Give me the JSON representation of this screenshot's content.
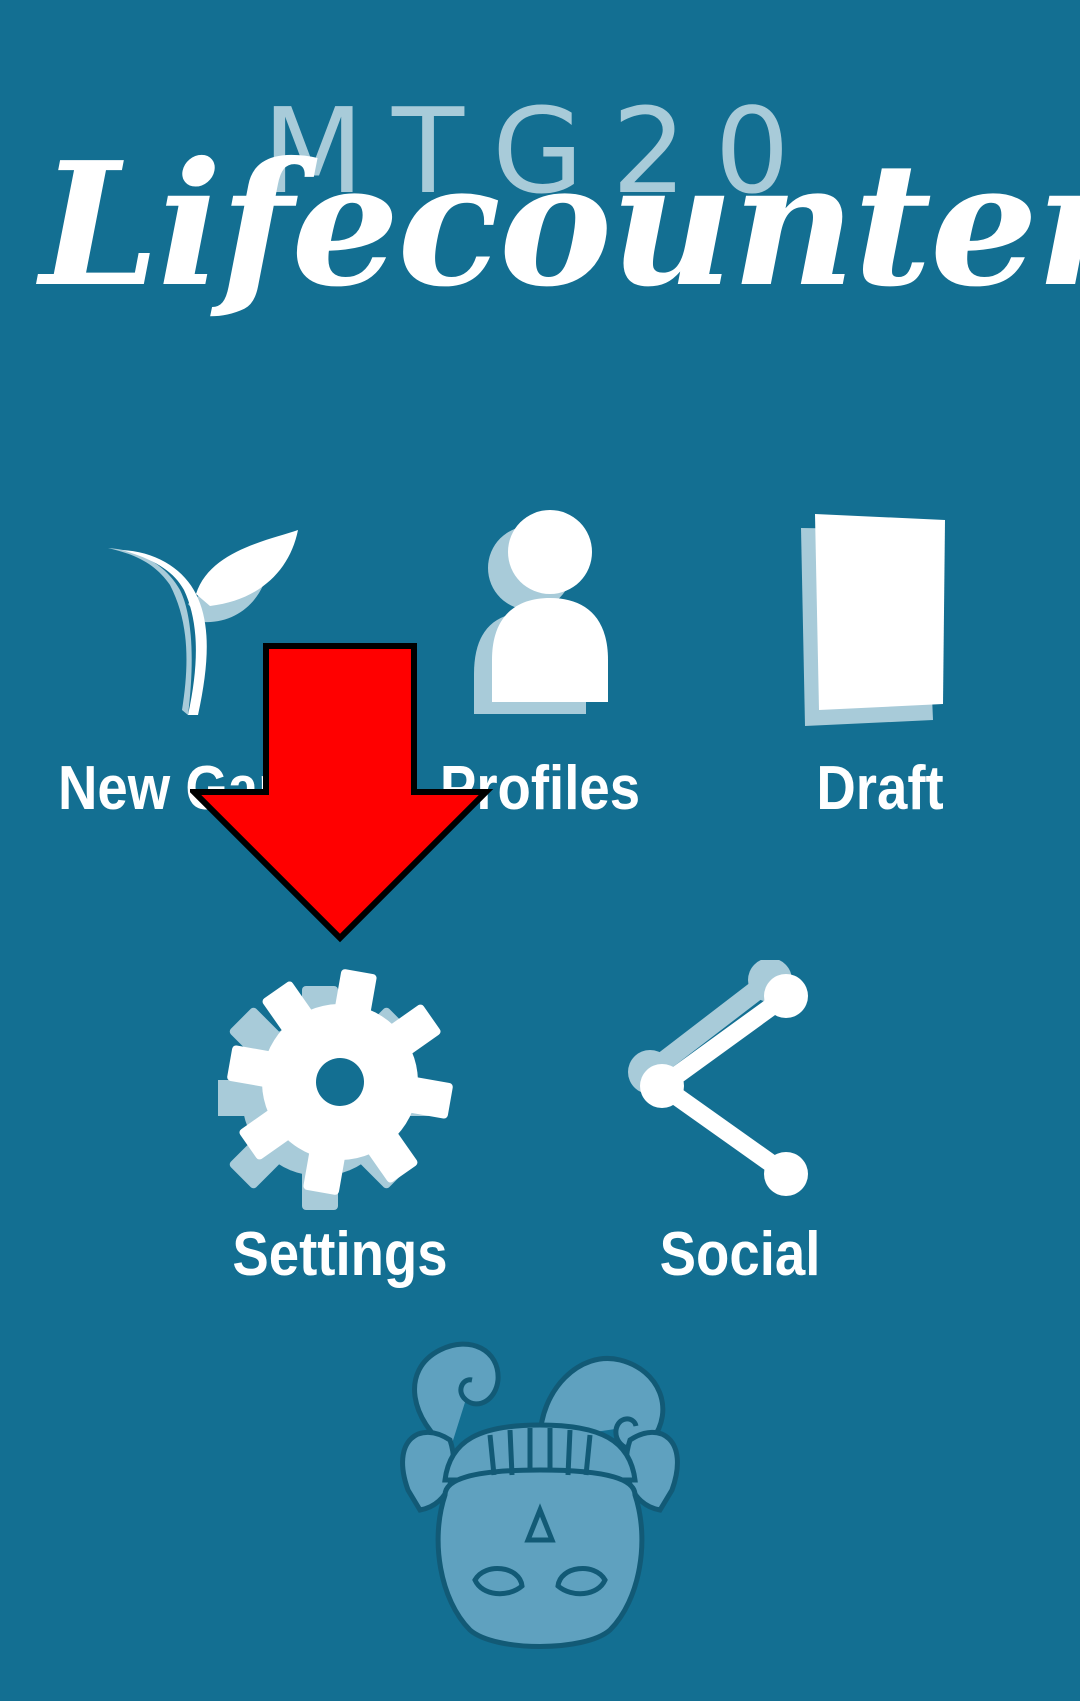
{
  "logo": {
    "prefix": "MTG20",
    "title": "Lifecounter"
  },
  "menu": {
    "new_game": {
      "label": "New Game",
      "icon": "sprout-icon"
    },
    "profiles": {
      "label": "Profiles",
      "icon": "person-icon"
    },
    "draft": {
      "label": "Draft",
      "icon": "card-icon"
    },
    "settings": {
      "label": "Settings",
      "icon": "gear-icon"
    },
    "social": {
      "label": "Social",
      "icon": "share-icon"
    }
  },
  "annotation": {
    "arrow_color": "#ff0000",
    "target": "settings"
  },
  "colors": {
    "background": "#136f92",
    "icon": "#ffffff",
    "icon_shadow": "#a8cbd9"
  }
}
